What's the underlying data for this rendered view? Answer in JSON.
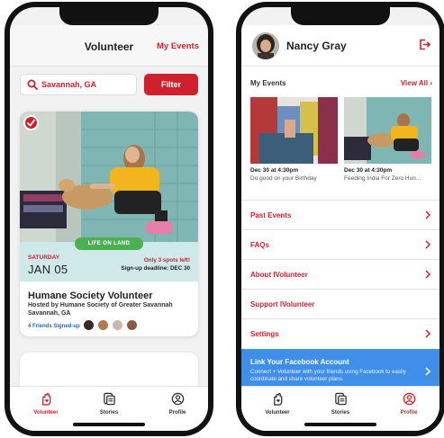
{
  "left_screen": {
    "header": {
      "title": "Volunteer",
      "my_events_link": "My Events"
    },
    "search": {
      "location": "Savannah, GA",
      "filter_label": "Filter"
    },
    "event": {
      "category_badge": "LIFE ON LAND",
      "weekday": "SATURDAY",
      "date": "JAN 05",
      "spots_left": "Only 3 spots left!",
      "signup_deadline": "Sign-up deadline: DEC 30",
      "title": "Humane Society Volunteer",
      "host": "Hosted by Humane Society of Greater Savannah",
      "location": "Savannah, GA",
      "friends_signed_up": "4 Friends Signed-up"
    },
    "tabs": [
      {
        "label": "Volunteer",
        "icon": "hand-heart-icon",
        "active": true
      },
      {
        "label": "Stories",
        "icon": "stories-icon",
        "active": false
      },
      {
        "label": "Profile",
        "icon": "profile-icon",
        "active": false
      }
    ]
  },
  "right_screen": {
    "header": {
      "name": "Nancy Gray",
      "logout_icon": "logout-icon"
    },
    "my_events": {
      "label": "My Events",
      "view_all": "View All",
      "items": [
        {
          "date": "Dec 30 at 4:30pm",
          "desc": "Do good on your Birthday"
        },
        {
          "date": "Dec 30 at 4:30pm",
          "desc": "Feeding India For Zero Hun..."
        }
      ]
    },
    "menu": [
      {
        "label": "Past Events"
      },
      {
        "label": "FAQs"
      },
      {
        "label": "About IVolunteer"
      },
      {
        "label": "Support IVolunteer"
      },
      {
        "label": "Settings"
      }
    ],
    "facebook_banner": {
      "title": "Link Your Facebook Account",
      "desc": "Connect + Volunteer with your friends using Facebook to easily coordinate and share volunteer plans."
    },
    "tabs": [
      {
        "label": "Volunteer",
        "icon": "hand-heart-icon",
        "active": false
      },
      {
        "label": "Stories",
        "icon": "stories-icon",
        "active": false
      },
      {
        "label": "Profile",
        "icon": "profile-icon",
        "active": true
      }
    ]
  },
  "colors": {
    "brand_red": "#d0202e",
    "teal_band": "#cfe9ea",
    "green_badge": "#4caf50",
    "facebook_blue": "#3f8fe8",
    "link_blue": "#1e66c5"
  }
}
